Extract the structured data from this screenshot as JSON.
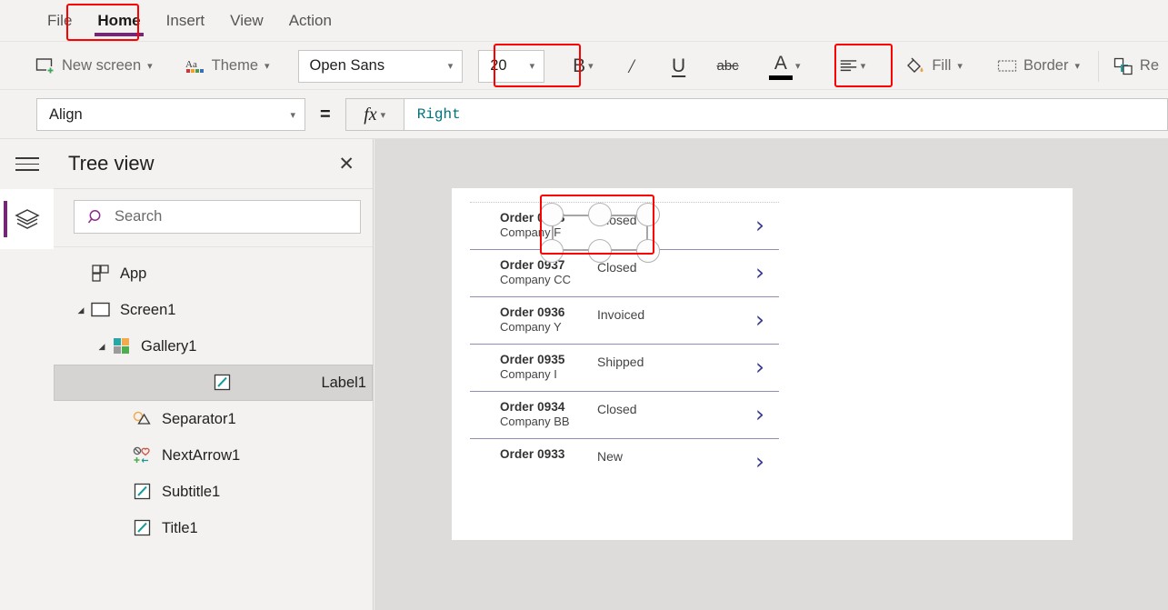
{
  "menu": {
    "items": [
      {
        "label": "File",
        "active": false
      },
      {
        "label": "Home",
        "active": true
      },
      {
        "label": "Insert",
        "active": false
      },
      {
        "label": "View",
        "active": false
      },
      {
        "label": "Action",
        "active": false
      }
    ]
  },
  "ribbon": {
    "new_screen_label": "New screen",
    "theme_label": "Theme",
    "font_family_value": "Open Sans",
    "font_size_value": "20",
    "bold_label": "B",
    "italic_label": "/",
    "underline_label": "U",
    "strikethrough_label": "abc",
    "font_color_label": "A",
    "fill_label": "Fill",
    "border_label": "Border",
    "reorder_label": "Re"
  },
  "formula_bar": {
    "property_value": "Align",
    "equals": "=",
    "fx_label": "fx",
    "formula_value": "Right"
  },
  "tree_view": {
    "title": "Tree view",
    "close_label": "✕",
    "search_placeholder": "Search",
    "nodes": [
      {
        "label": "App",
        "icon": "app-icon",
        "indent": 0,
        "twisty": "",
        "selected": false
      },
      {
        "label": "Screen1",
        "icon": "screen-icon",
        "indent": 0,
        "twisty": "◢",
        "selected": false
      },
      {
        "label": "Gallery1",
        "icon": "gallery-icon",
        "indent": 1,
        "twisty": "◢",
        "selected": false
      },
      {
        "label": "Label1",
        "icon": "label-icon",
        "indent": 2,
        "twisty": "",
        "selected": true
      },
      {
        "label": "Separator1",
        "icon": "separator-icon",
        "indent": 2,
        "twisty": "",
        "selected": false
      },
      {
        "label": "NextArrow1",
        "icon": "nextarrow-icon",
        "indent": 2,
        "twisty": "",
        "selected": false
      },
      {
        "label": "Subtitle1",
        "icon": "label-icon",
        "indent": 2,
        "twisty": "",
        "selected": false
      },
      {
        "label": "Title1",
        "icon": "label-icon",
        "indent": 2,
        "twisty": "",
        "selected": false
      }
    ]
  },
  "canvas": {
    "gallery_rows": [
      {
        "order": "Order 0938",
        "company": "Company F",
        "status": "Closed",
        "selected": true
      },
      {
        "order": "Order 0937",
        "company": "Company CC",
        "status": "Closed",
        "selected": false
      },
      {
        "order": "Order 0936",
        "company": "Company Y",
        "status": "Invoiced",
        "selected": false
      },
      {
        "order": "Order 0935",
        "company": "Company I",
        "status": "Shipped",
        "selected": false
      },
      {
        "order": "Order 0934",
        "company": "Company BB",
        "status": "Closed",
        "selected": false
      },
      {
        "order": "Order 0933",
        "company": "",
        "status": "New",
        "selected": false
      }
    ],
    "chevron_glyph": "›"
  },
  "colors": {
    "accent_purple": "#742774",
    "annotation_red": "#ff0000",
    "formula_teal": "#00727c",
    "chevron_blue": "#3b3b8f",
    "separator_blue": "#8d8db5"
  }
}
